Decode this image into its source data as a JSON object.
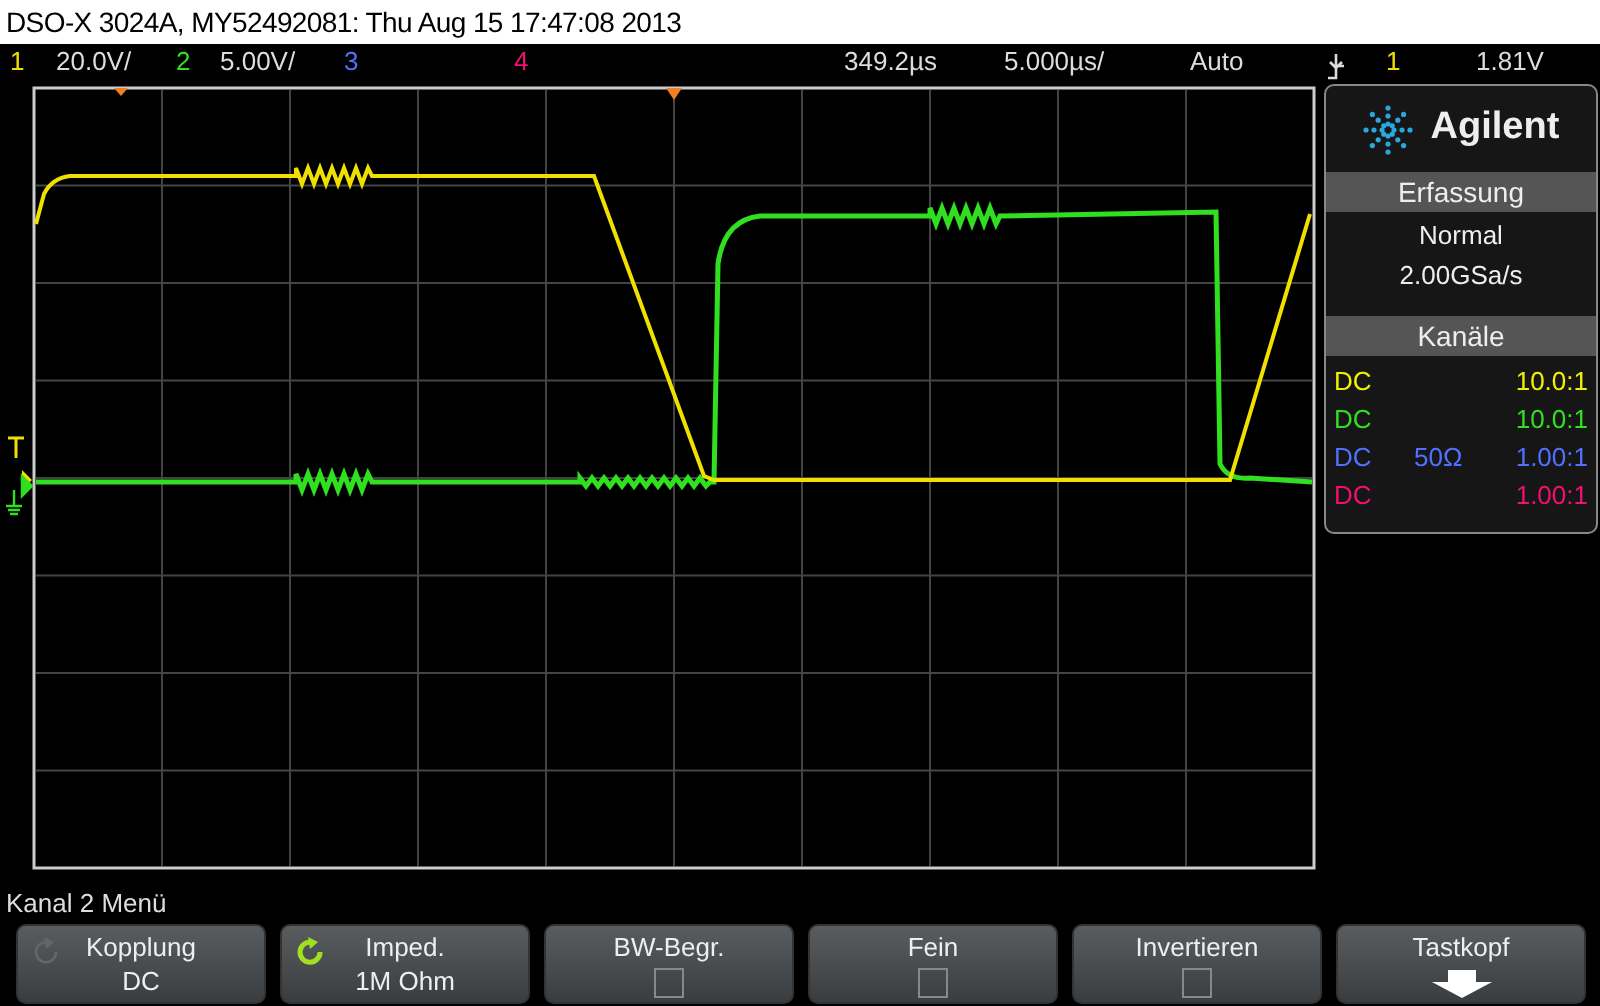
{
  "window": {
    "title": "DSO-X 3024A, MY52492081: Thu Aug 15 17:47:08 2013"
  },
  "status_bar": {
    "channels": [
      {
        "number": "1",
        "scale": "20.0V/",
        "color": "#f0e000"
      },
      {
        "number": "2",
        "scale": "5.00V/",
        "color": "#30e020"
      },
      {
        "number": "3",
        "color": "#5070ff"
      },
      {
        "number": "4",
        "color": "#f01070"
      }
    ],
    "delay": "349.2µs",
    "timebase": "5.000µs/",
    "trigger": {
      "mode": "Auto",
      "source": "1",
      "color": "#f0e000",
      "level": "1.81V"
    }
  },
  "side_panel": {
    "brand": "Agilent",
    "acquisition": {
      "heading": "Erfassung",
      "mode": "Normal",
      "rate": "2.00GSa/s"
    },
    "channels_heading": "Kanäle",
    "channels": [
      {
        "coupling": "DC",
        "ratio": "10.0:1",
        "color": "#f0f000"
      },
      {
        "coupling": "DC",
        "ratio": "10.0:1",
        "color": "#30e020"
      },
      {
        "coupling": "DC",
        "impedance": "50Ω",
        "ratio": "1.00:1",
        "color": "#5070ff"
      },
      {
        "coupling": "DC",
        "ratio": "1.00:1",
        "color": "#f01070"
      }
    ]
  },
  "menu": {
    "title": "Kanal 2 Menü",
    "softkeys": [
      {
        "kind": "value",
        "label": "Kopplung",
        "value": "DC",
        "selectable": false
      },
      {
        "kind": "value",
        "label": "Imped.",
        "value": "1M Ohm",
        "selectable": true
      },
      {
        "kind": "checkbox",
        "label": "BW-Begr.",
        "checked": false
      },
      {
        "kind": "checkbox",
        "label": "Fein",
        "checked": false
      },
      {
        "kind": "checkbox",
        "label": "Invertieren",
        "checked": false
      },
      {
        "kind": "submenu",
        "label": "Tastkopf"
      }
    ]
  }
}
